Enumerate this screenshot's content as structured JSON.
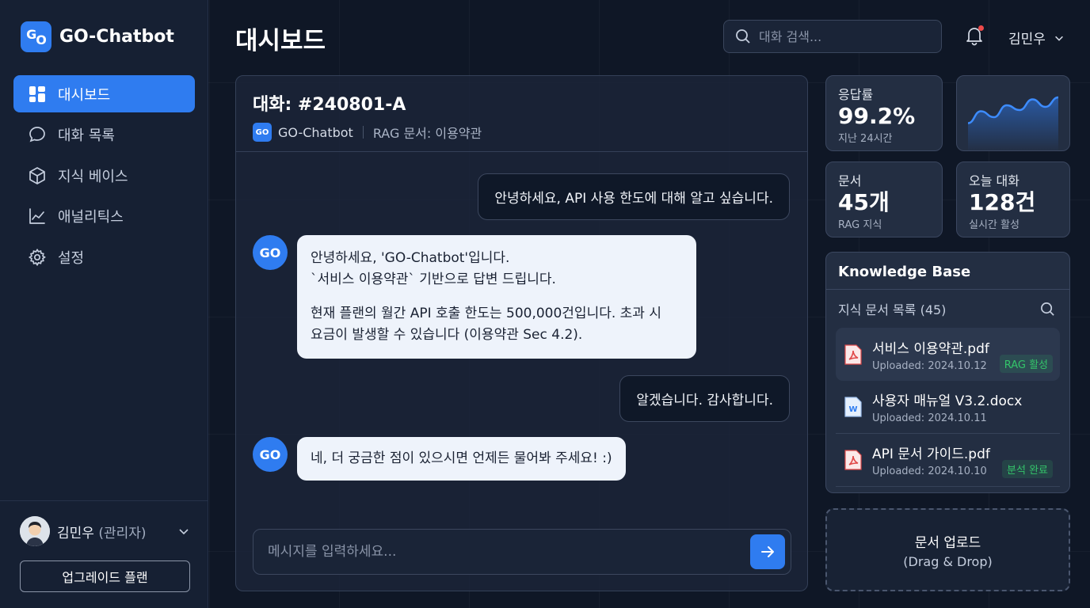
{
  "app": {
    "name": "GO-Chatbot",
    "logo_text_g": "G",
    "logo_text_o": "O"
  },
  "sidebar": {
    "items": [
      {
        "label": "대시보드",
        "icon": "dashboard-icon",
        "active": true
      },
      {
        "label": "대화 목록",
        "icon": "chat-bubble-icon",
        "active": false
      },
      {
        "label": "지식 베이스",
        "icon": "cube-icon",
        "active": false
      },
      {
        "label": "애널리틱스",
        "icon": "chart-line-icon",
        "active": false
      },
      {
        "label": "설정",
        "icon": "gear-icon",
        "active": false
      }
    ],
    "user": {
      "name": "김민우",
      "role": "(관리자)"
    },
    "upgrade_label": "업그레이드 플랜"
  },
  "header": {
    "title": "대시보드",
    "search_placeholder": "대화 검색...",
    "user_name": "김민우",
    "notification_dot_color": "#ef4a4a"
  },
  "chat": {
    "title": "대화: #240801-A",
    "bot_name": "GO-Chatbot",
    "rag_doc": "RAG 문서: 이용약관",
    "messages": [
      {
        "from": "user",
        "text": "안녕하세요, API 사용 한도에 대해 알고 싶습니다."
      },
      {
        "from": "bot",
        "paragraphs": [
          "안녕하세요, 'GO-Chatbot'입니다.",
          "`서비스 이용약관` 기반으로 답변 드립니다.",
          "현재 플랜의 월간 API 호출 한도는 500,000건입니다. 초과 시",
          "요금이 발생할 수 있습니다 (이용약관 Sec 4.2)."
        ]
      },
      {
        "from": "user",
        "text": "알겠습니다. 감사합니다."
      },
      {
        "from": "bot",
        "paragraphs": [
          "네, 더 궁금한 점이 있으시면 언제든 물어봐 주세요! :)"
        ]
      }
    ],
    "input_placeholder": "메시지를 입력하세요..."
  },
  "stats": {
    "response_rate": {
      "label": "응답률",
      "value": "99.2%",
      "sub": "지난 24시간"
    },
    "documents": {
      "label": "문서",
      "value": "45개",
      "sub": "RAG 지식"
    },
    "today_chats": {
      "label": "오늘 대화",
      "value": "128건",
      "sub": "실시간 활성"
    },
    "sparkline": [
      0.25,
      0.55,
      0.4,
      0.7,
      0.58,
      0.85,
      0.66,
      0.9
    ]
  },
  "knowledge_base": {
    "title": "Knowledge Base",
    "list_label": "지식 문서 목록 (45)",
    "files": [
      {
        "name": "서비스 이용약관.pdf",
        "date": "Uploaded: 2024.10.12",
        "badge": "RAG 활성",
        "type": "pdf",
        "selected": true
      },
      {
        "name": "사용자 매뉴얼 V3.2.docx",
        "date": "Uploaded: 2024.10.11",
        "badge": "",
        "type": "docx",
        "selected": false
      },
      {
        "name": "API 문서 가이드.pdf",
        "date": "Uploaded: 2024.10.10",
        "badge": "분석 완료",
        "type": "pdf",
        "selected": false
      }
    ]
  },
  "upload": {
    "title": "문서 업로드",
    "sub": "(Drag & Drop)"
  },
  "colors": {
    "accent": "#2f7cf0",
    "success": "#34c46a",
    "background": "#0f1726"
  }
}
